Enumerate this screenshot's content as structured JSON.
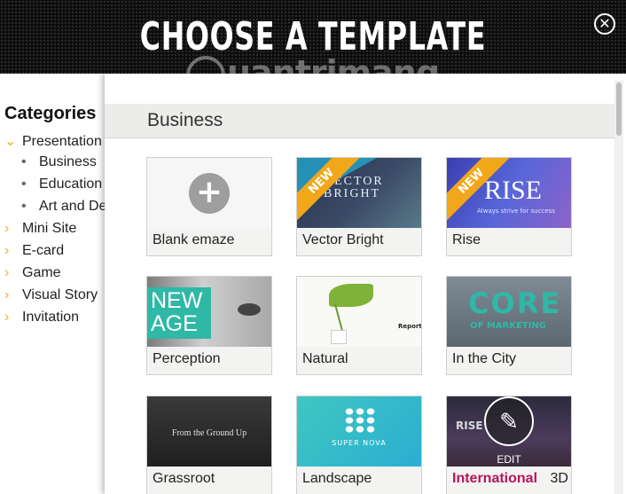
{
  "header": {
    "title": "CHOOSE A TEMPLATE",
    "close_icon": "close-circle-icon"
  },
  "watermark": {
    "text": "uantrimang"
  },
  "sidebar": {
    "title": "Categories",
    "items": [
      {
        "label": "Presentation",
        "expanded": true
      },
      {
        "label": "Business"
      },
      {
        "label": "Education"
      },
      {
        "label": "Art and Design"
      },
      {
        "label": "Mini Site"
      },
      {
        "label": "E-card"
      },
      {
        "label": "Game"
      },
      {
        "label": "Visual Story"
      },
      {
        "label": "Invitation"
      }
    ]
  },
  "main": {
    "section_title": "Business",
    "templates": [
      {
        "label": "Blank emaze"
      },
      {
        "label": "Vector Bright",
        "badge": "NEW",
        "thumb_text": "VECTOR\nBRIGHT"
      },
      {
        "label": "Rise",
        "badge": "NEW",
        "thumb_text": "RISE",
        "thumb_sub": "Always strive for success"
      },
      {
        "label": "Perception",
        "thumb_text": "NEW\nAGE"
      },
      {
        "label": "Natural",
        "thumb_text": "Report"
      },
      {
        "label": "In the City",
        "thumb_text": "CORE",
        "thumb_sub": "OF MARKETING"
      },
      {
        "label": "Grassroot",
        "thumb_text": "From the Ground Up"
      },
      {
        "label": "Landscape",
        "thumb_text": "SUPER NOVA"
      },
      {
        "label": "International",
        "label_suffix": "3D",
        "thumb_text": "RISE",
        "hover_action": "EDIT"
      }
    ]
  },
  "colors": {
    "accent": "#f2a71b",
    "ribbon": "#f2a71b",
    "international_label": "#b3155e",
    "teal": "#2fb8a6"
  }
}
